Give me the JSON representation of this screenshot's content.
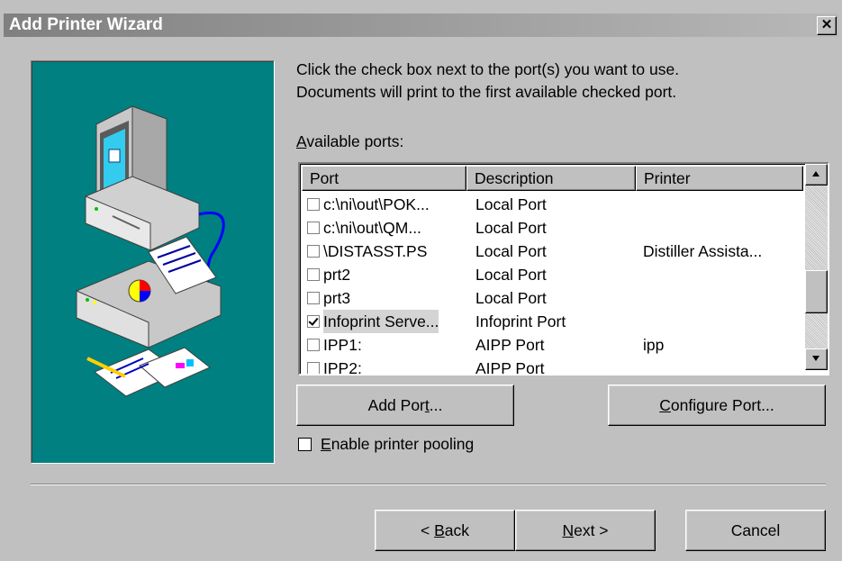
{
  "window": {
    "title": "Add Printer Wizard",
    "close_glyph": "✕"
  },
  "instructions": {
    "line1": "Click the check box next to the port(s) you want to use.",
    "line2": "Documents will print to the first available checked port."
  },
  "ports_label": {
    "mnemonic": "A",
    "rest": "vailable ports:"
  },
  "columns": {
    "port": "Port",
    "description": "Description",
    "printer": "Printer"
  },
  "ports": [
    {
      "port": "c:\\ni\\out\\POK...",
      "description": "Local Port",
      "printer": "",
      "checked": false
    },
    {
      "port": "c:\\ni\\out\\QM...",
      "description": "Local Port",
      "printer": "",
      "checked": false
    },
    {
      "port": "\\DISTASST.PS",
      "description": "Local Port",
      "printer": "Distiller Assista...",
      "checked": false
    },
    {
      "port": "prt2",
      "description": "Local Port",
      "printer": "",
      "checked": false
    },
    {
      "port": "prt3",
      "description": "Local Port",
      "printer": "",
      "checked": false
    },
    {
      "port": "Infoprint Serve...",
      "description": "Infoprint Port",
      "printer": "",
      "checked": true
    },
    {
      "port": "IPP1:",
      "description": "AIPP Port",
      "printer": "ipp",
      "checked": false
    },
    {
      "port": "IPP2:",
      "description": "AIPP Port",
      "printer": "",
      "checked": false
    }
  ],
  "buttons": {
    "add_port": {
      "pre": "Add Por",
      "mnemonic": "t",
      "post": "..."
    },
    "configure_port": {
      "pre": "",
      "mnemonic": "C",
      "post": "onfigure Port..."
    },
    "back": {
      "pre": "< ",
      "mnemonic": "B",
      "post": "ack"
    },
    "next": {
      "pre": "",
      "mnemonic": "N",
      "post": "ext >"
    },
    "cancel": "Cancel"
  },
  "pooling": {
    "mnemonic": "E",
    "rest": "nable printer pooling",
    "checked": false
  }
}
